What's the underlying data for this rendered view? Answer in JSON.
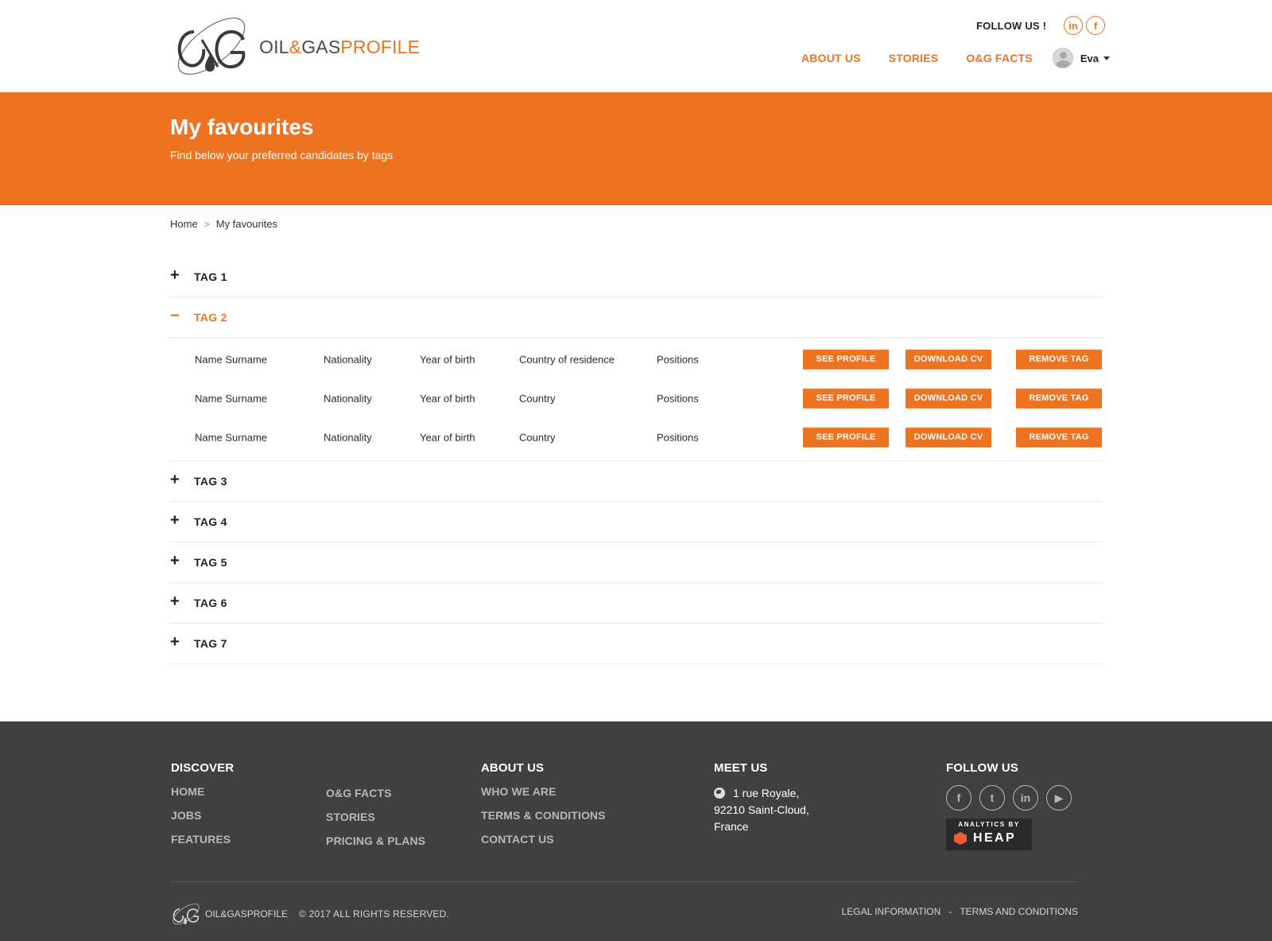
{
  "header": {
    "logo": {
      "oil": "OIL",
      "amp": "&",
      "gas": "GAS",
      "profile": "PROFILE"
    },
    "follow_label": "FOLLOW US !",
    "follow_icons": [
      "in",
      "f"
    ],
    "nav": [
      "ABOUT US",
      "STORIES",
      "O&G FACTS"
    ],
    "user": "Eva"
  },
  "banner": {
    "title": "My favourites",
    "subtitle": "Find below your preferred candidates by tags"
  },
  "breadcrumb": {
    "home": "Home",
    "separator": ">",
    "current": "My favourites"
  },
  "tags": [
    {
      "label": "TAG 1",
      "toggle": "+"
    },
    {
      "label": "TAG 2",
      "toggle": "−"
    },
    {
      "label": "TAG 3",
      "toggle": "+"
    },
    {
      "label": "TAG 4",
      "toggle": "+"
    },
    {
      "label": "TAG 5",
      "toggle": "+"
    },
    {
      "label": "TAG 6",
      "toggle": "+"
    },
    {
      "label": "TAG 7",
      "toggle": "+"
    }
  ],
  "candidates": [
    {
      "name": "Name Surname",
      "nationality": "Nationality",
      "year": "Year of birth",
      "country": "Country of residence",
      "positions": "Positions"
    },
    {
      "name": "Name Surname",
      "nationality": "Nationality",
      "year": "Year of birth",
      "country": "Country",
      "positions": "Positions"
    },
    {
      "name": "Name Surname",
      "nationality": "Nationality",
      "year": "Year of birth",
      "country": "Country",
      "positions": "Positions"
    }
  ],
  "buttons": {
    "see": "SEE PROFILE",
    "download": "DOWNLOAD CV",
    "remove": "REMOVE TAG"
  },
  "footer": {
    "discover": {
      "heading": "DISCOVER",
      "col1": [
        "HOME",
        "JOBS",
        "FEATURES"
      ],
      "col2": [
        "O&G FACTS",
        "STORIES",
        "PRICING & PLANS"
      ]
    },
    "about": {
      "heading": "ABOUT US",
      "links": [
        "WHO WE ARE",
        "TERMS & CONDITIONS",
        "CONTACT US"
      ]
    },
    "meet": {
      "heading": "MEET US",
      "address": [
        "1 rue Royale,",
        "92210 Saint-Cloud,",
        "France"
      ]
    },
    "follow": {
      "heading": "FOLLOW US",
      "icons": [
        "f",
        "t",
        "in",
        "▶"
      ]
    },
    "heap": {
      "top": "ANALYTICS BY",
      "word": "HEAP"
    },
    "logo_text": "OIL&GASPROFILE",
    "copyright": "© 2017 ALL RIGHTS RESERVED.",
    "legal": "LEGAL INFORMATION",
    "legal_sep": "-",
    "terms": "TERMS AND CONDITIONS"
  },
  "colors": {
    "accent": "#ee7320",
    "footer_bg": "#404040",
    "row_shade": "#f5f6f8"
  }
}
